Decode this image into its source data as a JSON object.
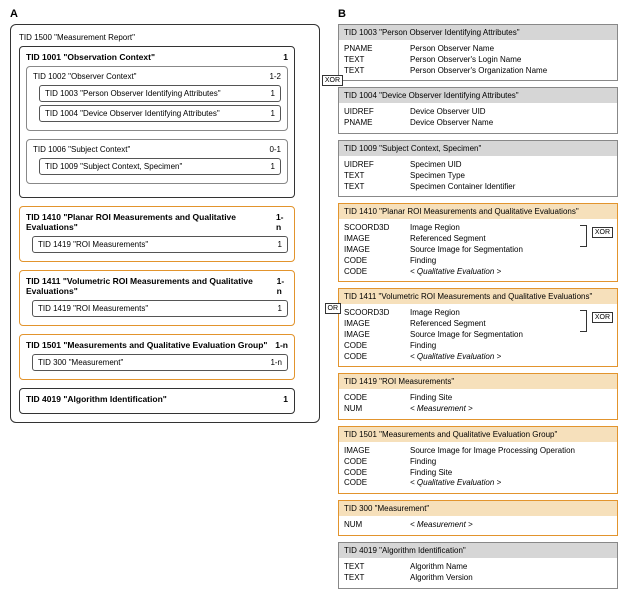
{
  "panelA": {
    "label": "A",
    "outer": {
      "id": "TID 1500",
      "name": "\"Measurement Report\""
    },
    "tid1001": {
      "id": "TID 1001",
      "name": "\"Observation Context\"",
      "card": "1"
    },
    "tid1002": {
      "id": "TID 1002",
      "name": "\"Observer Context\"",
      "card": "1-2"
    },
    "tid1003": {
      "id": "TID 1003",
      "name": "\"Person Observer Identifying Attributes\"",
      "card": "1"
    },
    "tid1004": {
      "id": "TID 1004",
      "name": "\"Device Observer Identifying Attributes\"",
      "card": "1"
    },
    "tid1006": {
      "id": "TID 1006",
      "name": "\"Subject Context\"",
      "card": "0-1"
    },
    "tid1009": {
      "id": "TID 1009",
      "name": "\"Subject Context, Specimen\"",
      "card": "1"
    },
    "tid1410": {
      "id": "TID 1410",
      "name": "\"Planar ROI Measurements and Qualitative Evaluations\"",
      "card": "1-n"
    },
    "tid1419a": {
      "id": "TID 1419",
      "name": "\"ROI Measurements\"",
      "card": "1"
    },
    "tid1411": {
      "id": "TID 1411",
      "name": "\"Volumetric ROI Measurements and Qualitative Evaluations\"",
      "card": "1-n"
    },
    "tid1419b": {
      "id": "TID 1419",
      "name": "\"ROI Measurements\"",
      "card": "1"
    },
    "tid1501": {
      "id": "TID 1501",
      "name": "\"Measurements and Qualitative Evaluation Group\"",
      "card": "1-n"
    },
    "tid300": {
      "id": "TID 300",
      "name": "\"Measurement\"",
      "card": "1-n"
    },
    "tid4019": {
      "id": "TID 4019",
      "name": "\"Algorithm Identification\"",
      "card": "1"
    },
    "xor": "XOR",
    "or": "OR"
  },
  "panelB": {
    "label": "B",
    "xor": "XOR",
    "b1003": {
      "title": "TID 1003 \"Person Observer Identifying Attributes\"",
      "rows": [
        {
          "k": "PNAME",
          "v": "Person Observer Name"
        },
        {
          "k": "TEXT",
          "v": "Person Observer's Login Name"
        },
        {
          "k": "TEXT",
          "v": "Person Observer's Organization Name"
        }
      ]
    },
    "b1004": {
      "title": "TID 1004 \"Device Observer Identifying Attributes\"",
      "rows": [
        {
          "k": "UIDREF",
          "v": "Device Observer UID"
        },
        {
          "k": "PNAME",
          "v": "Device Observer Name"
        }
      ]
    },
    "b1009": {
      "title": "TID 1009 \"Subject Context, Specimen\"",
      "rows": [
        {
          "k": "UIDREF",
          "v": "Specimen UID"
        },
        {
          "k": "TEXT",
          "v": "Specimen Type"
        },
        {
          "k": "TEXT",
          "v": "Specimen Container Identifier"
        }
      ]
    },
    "b1410": {
      "title": "TID 1410 \"Planar ROI Measurements and Qualitative Evaluations\"",
      "rows": [
        {
          "k": "SCOORD3D",
          "v": "Image Region"
        },
        {
          "k": "IMAGE",
          "v": "Referenced Segment"
        },
        {
          "k": "IMAGE",
          "v": "Source Image for Segmentation"
        },
        {
          "k": "CODE",
          "v": "Finding"
        },
        {
          "k": "CODE",
          "v": "< Qualitative Evaluation >",
          "ital": true
        }
      ]
    },
    "b1411": {
      "title": "TID 1411 \"Volumetric ROI Measurements and Qualitative Evaluations\"",
      "rows": [
        {
          "k": "SCOORD3D",
          "v": "Image Region"
        },
        {
          "k": "IMAGE",
          "v": "Referenced Segment"
        },
        {
          "k": "IMAGE",
          "v": "Source Image for Segmentation"
        },
        {
          "k": "CODE",
          "v": "Finding"
        },
        {
          "k": "CODE",
          "v": "< Qualitative Evaluation >",
          "ital": true
        }
      ]
    },
    "b1419": {
      "title": "TID 1419 \"ROI Measurements\"",
      "rows": [
        {
          "k": "CODE",
          "v": "Finding Site"
        },
        {
          "k": "NUM",
          "v": "< Measurement >",
          "ital": true
        }
      ]
    },
    "b1501": {
      "title": "TID 1501 \"Measurements and Qualitative Evaluation Group\"",
      "rows": [
        {
          "k": "IMAGE",
          "v": "Source Image for Image Processing Operation"
        },
        {
          "k": "CODE",
          "v": "Finding"
        },
        {
          "k": "CODE",
          "v": "Finding Site"
        },
        {
          "k": "CODE",
          "v": "< Qualitative Evaluation >",
          "ital": true
        }
      ]
    },
    "b300": {
      "title": "TID 300 \"Measurement\"",
      "rows": [
        {
          "k": "NUM",
          "v": "< Measurement >",
          "ital": true
        }
      ]
    },
    "b4019": {
      "title": "TID 4019 \"Algorithm Identification\"",
      "rows": [
        {
          "k": "TEXT",
          "v": "Algorithm Name"
        },
        {
          "k": "TEXT",
          "v": "Algorithm Version"
        }
      ]
    }
  }
}
